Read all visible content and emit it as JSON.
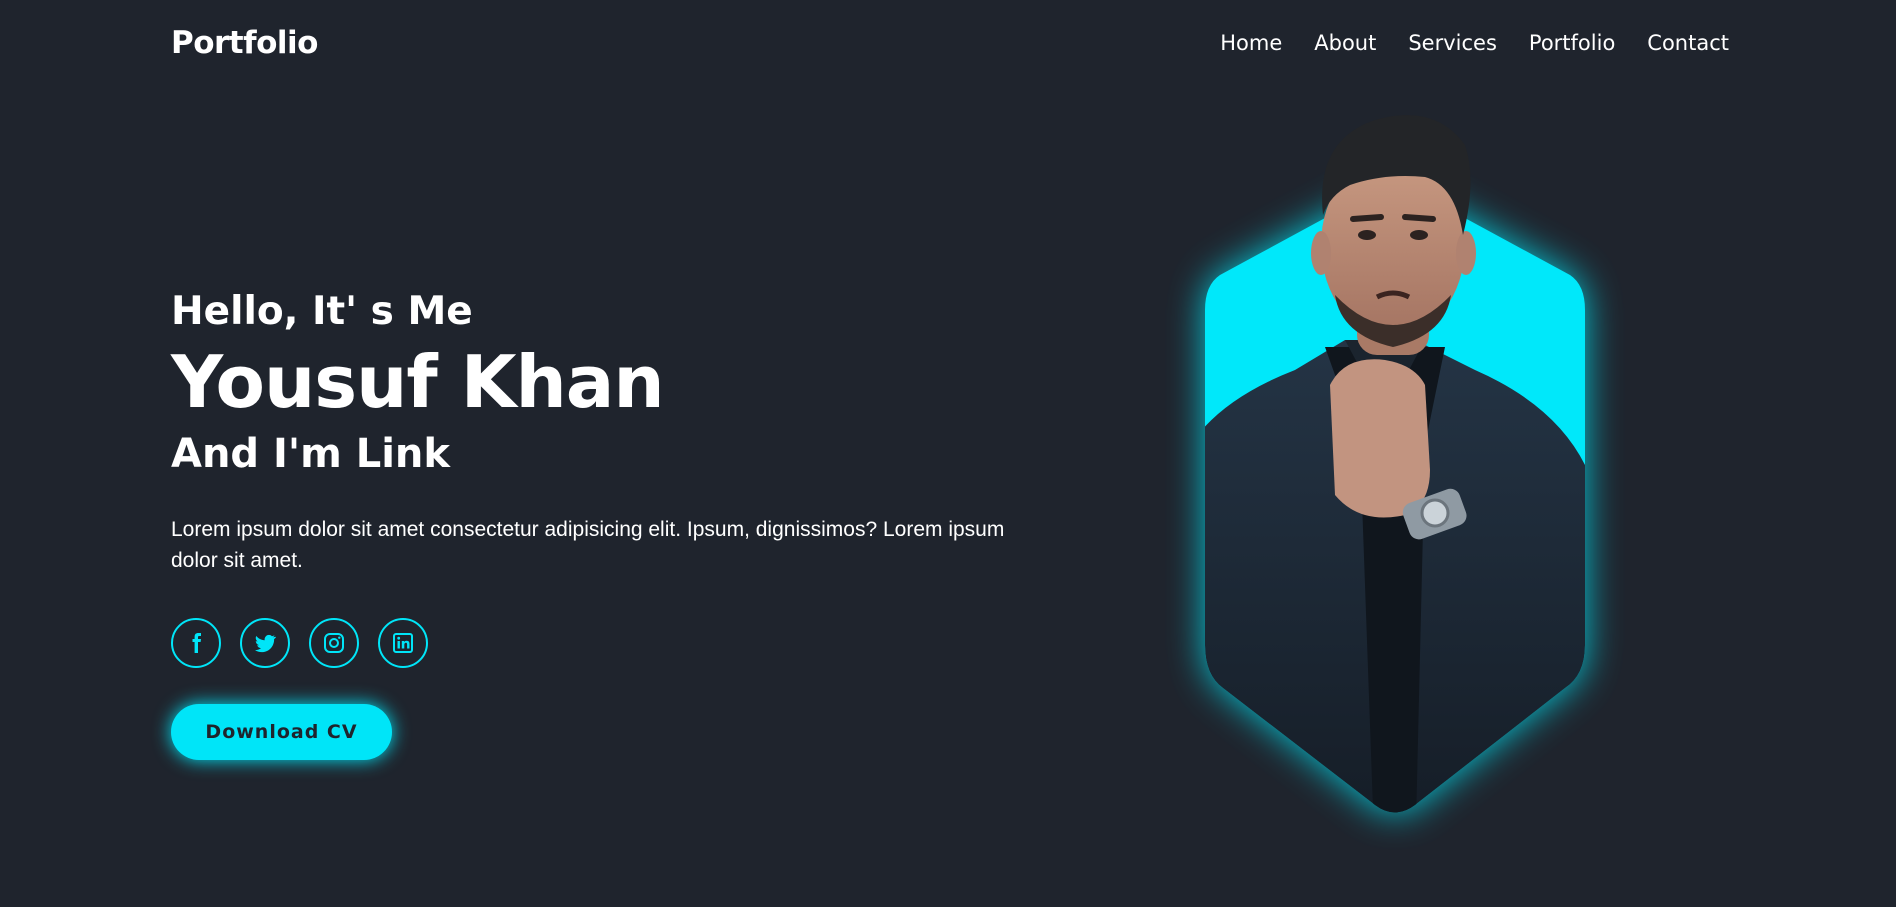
{
  "header": {
    "logo": "Portfolio",
    "nav": [
      "Home",
      "About",
      "Services",
      "Portfolio",
      "Contact"
    ]
  },
  "hero": {
    "greeting": "Hello, It' s Me",
    "name": "Yousuf Khan",
    "role": "And I'm Link",
    "description": "Lorem ipsum dolor sit amet consectetur adipisicing elit. Ipsum, dignissimos? Lorem ipsum dolor sit amet.",
    "socials": [
      "facebook-icon",
      "twitter-icon",
      "instagram-icon",
      "linkedin-icon"
    ],
    "cta_label": "Download CV"
  },
  "colors": {
    "background": "#1f242d",
    "accent": "#00e5f8",
    "text": "#ffffff"
  }
}
